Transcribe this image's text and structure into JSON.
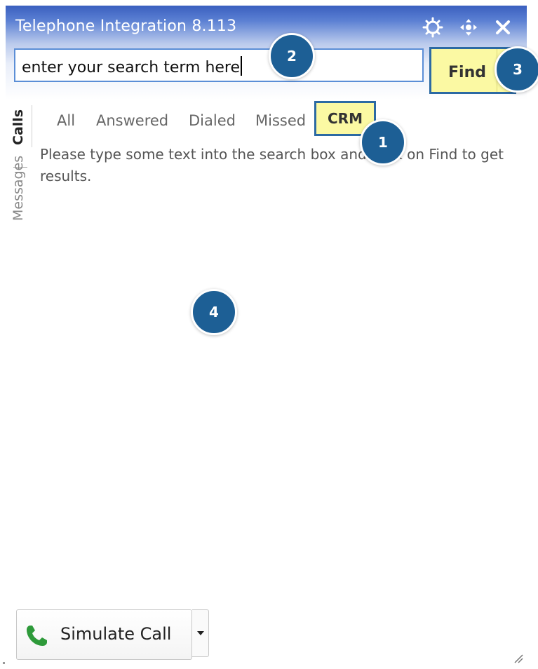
{
  "window": {
    "title": "Telephone Integration 8.113",
    "header_icons": [
      "gear-icon",
      "move-icon",
      "close-icon"
    ]
  },
  "search": {
    "value": "enter your search term here",
    "find_label": "Find"
  },
  "side_tabs": [
    {
      "label": "Calls",
      "active": true
    },
    {
      "label": "Messages",
      "active": false
    }
  ],
  "filters": [
    {
      "label": "All"
    },
    {
      "label": "Answered"
    },
    {
      "label": "Dialed"
    },
    {
      "label": "Missed"
    },
    {
      "label": "CRM",
      "highlighted": true
    }
  ],
  "message": "Please type some text into the search box and click on Find to get results.",
  "callouts": [
    "1",
    "2",
    "3",
    "4"
  ],
  "footer": {
    "simulate_label": "Simulate Call",
    "phone_icon": "phone-icon",
    "dropdown_icon": "caret-down-icon"
  },
  "colors": {
    "highlight": "#fbf9a3",
    "callout": "#1d5f95",
    "header_top": "#3a5fbf",
    "search_border": "#5b8ed6",
    "phone": "#2e9a3a"
  }
}
